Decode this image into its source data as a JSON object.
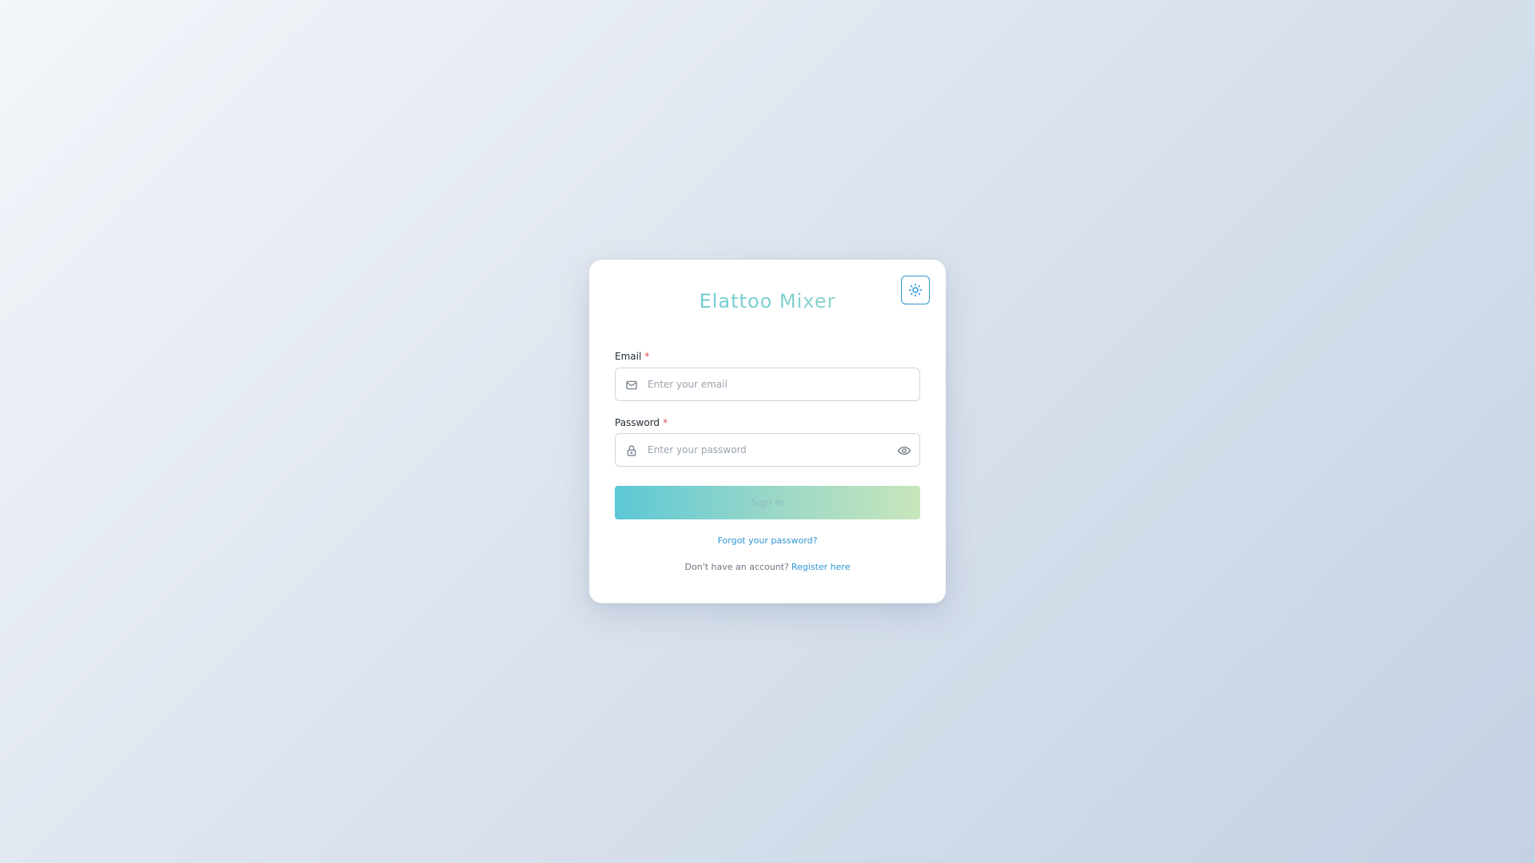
{
  "app": {
    "title": "Elattoo Mixer"
  },
  "theme_toggle": {
    "icon": "sun-icon"
  },
  "email": {
    "label": "Email",
    "required_mark": "*",
    "placeholder": "Enter your email",
    "value": "",
    "icon": "mail-icon"
  },
  "password": {
    "label": "Password",
    "required_mark": "*",
    "placeholder": "Enter your password",
    "value": "",
    "icon": "lock-icon",
    "toggle_icon": "eye-icon"
  },
  "actions": {
    "sign_in_label": "Sign In",
    "forgot_label": "Forgot your password?",
    "register_prompt": "Don't have an account?",
    "register_label": "Register here"
  },
  "colors": {
    "accent": "#2f95d4",
    "gradient_start": "#5bc8d6",
    "gradient_end": "#c8e6bb",
    "required": "#e5484d"
  }
}
